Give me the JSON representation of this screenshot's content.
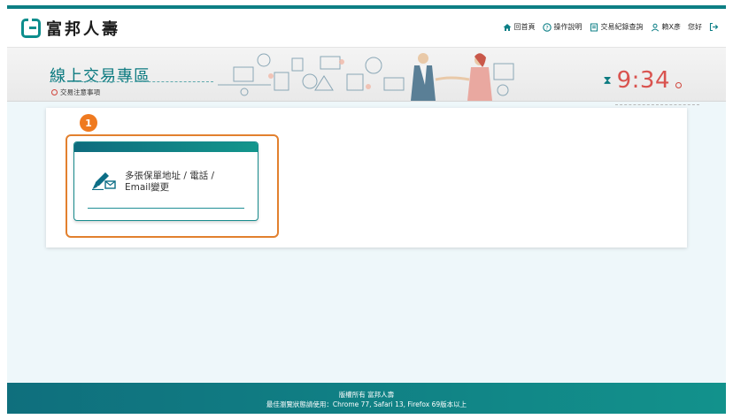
{
  "header": {
    "brand": "富邦人壽",
    "nav": [
      {
        "label": "回首頁",
        "icon": "home-icon"
      },
      {
        "label": "操作說明",
        "icon": "help-icon"
      },
      {
        "label": "交易紀錄查詢",
        "icon": "record-icon"
      },
      {
        "label": "賴X彥",
        "icon": "user-icon"
      },
      {
        "label": "您好",
        "icon": ""
      }
    ],
    "logout_icon": "logout-icon"
  },
  "banner": {
    "title": "線上交易專區",
    "notice": "交易注意事項",
    "timer": "9:34"
  },
  "main": {
    "step_number": "1",
    "transaction_card": {
      "label": "多張保單地址 / 電話 / Email變更",
      "icon": "edit-mail-icon"
    }
  },
  "footer": {
    "copyright": "版權所有 富邦人壽",
    "browser_note": "最佳瀏覽狀態請使用：Chrome 77, Safari 13, Firefox 69版本以上"
  },
  "colors": {
    "primary": "#0c7f86",
    "accent": "#ef7a20",
    "timer": "#d9534f"
  }
}
